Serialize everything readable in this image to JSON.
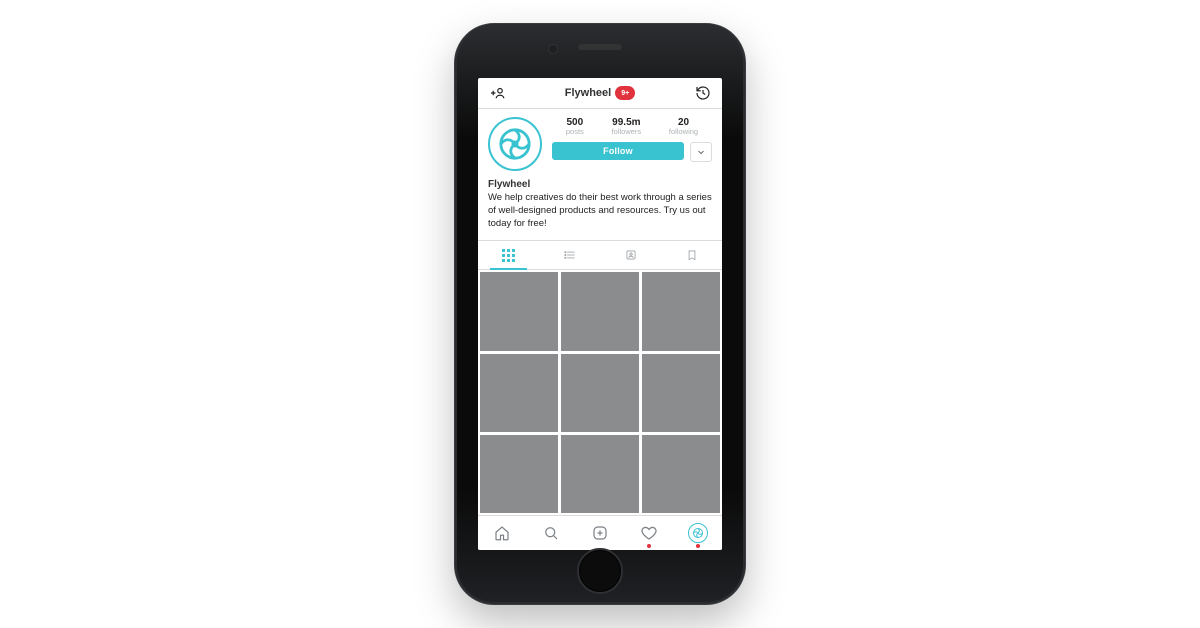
{
  "header": {
    "title": "Flywheel",
    "notification_badge": "9+"
  },
  "profile": {
    "stats": {
      "posts": {
        "value": "500",
        "label": "posts"
      },
      "followers": {
        "value": "99.5m",
        "label": "followers"
      },
      "following": {
        "value": "20",
        "label": "following"
      }
    },
    "follow_button_label": "Follow",
    "display_name": "Flywheel",
    "bio": "We help creatives do their best work through a series of well-designed products and resources. Try us out today for free!"
  },
  "view_tabs": {
    "grid": {
      "icon": "grid-icon",
      "active": true
    },
    "list": {
      "icon": "list-icon",
      "active": false
    },
    "tagged": {
      "icon": "portrait-icon",
      "active": false
    },
    "saved": {
      "icon": "bookmark-icon",
      "active": false
    }
  },
  "post_grid": {
    "tile_count": 9
  },
  "bottom_nav": {
    "home": {
      "icon": "home-icon"
    },
    "search": {
      "icon": "search-icon"
    },
    "create": {
      "icon": "add-post-icon"
    },
    "activity": {
      "icon": "heart-icon",
      "has_alert": true
    },
    "account": {
      "icon": "profile-avatar-icon",
      "has_alert": true,
      "active": true
    }
  },
  "colors": {
    "brand": "#39c2d0",
    "alert": "#e0333e",
    "tile": "#8b8c8e"
  }
}
